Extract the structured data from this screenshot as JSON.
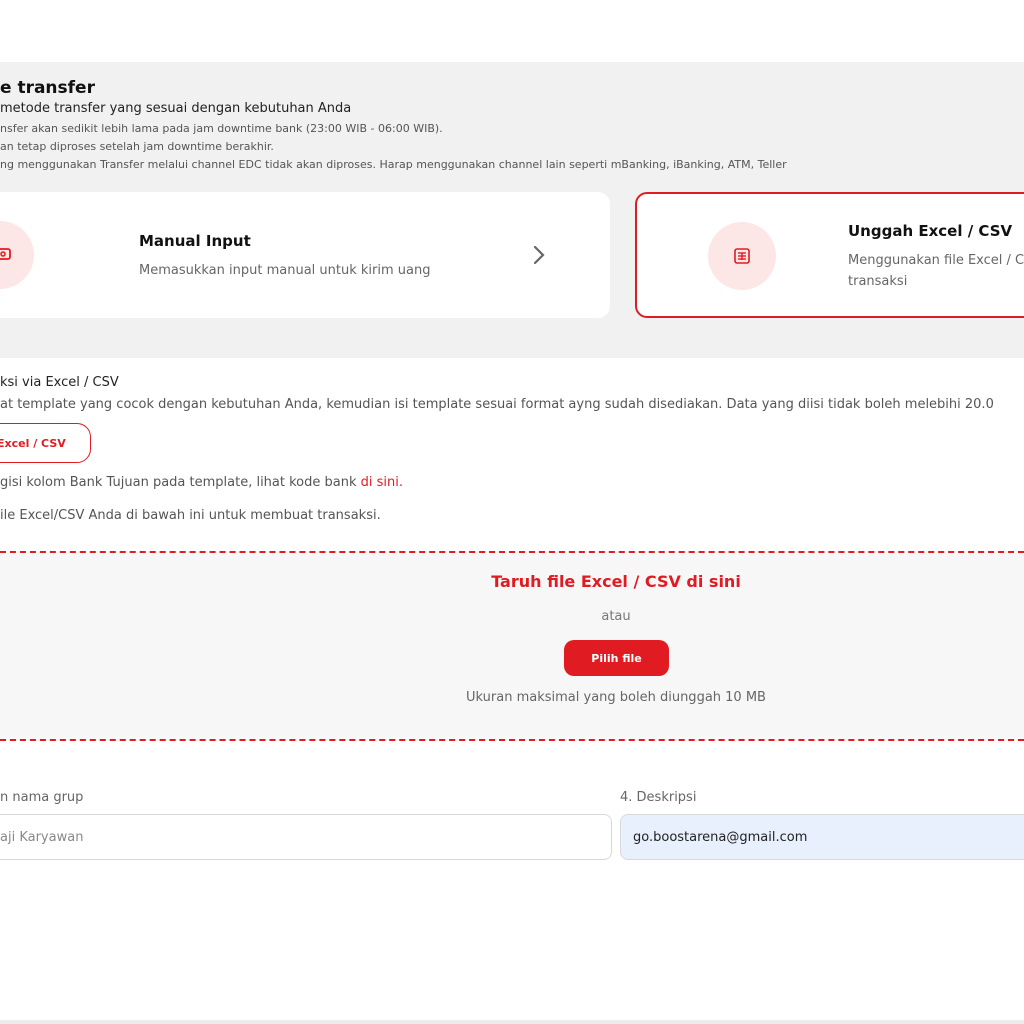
{
  "method": {
    "title": "e transfer",
    "subtitle": "metode transfer yang sesuai dengan kebutuhan Anda",
    "notes": [
      "nsfer akan sedikit lebih lama pada jam downtime bank (23:00 WIB - 06:00 WIB).",
      "an tetap diproses setelah jam downtime berakhir.",
      "ng menggunakan Transfer melalui channel EDC tidak akan diproses. Harap menggunakan channel lain seperti mBanking, iBanking, ATM, Teller"
    ],
    "cards": {
      "manual": {
        "title": "Manual Input",
        "desc": "Memasukkan input manual untuk kirim uang"
      },
      "upload": {
        "title": "Unggah Excel / CSV",
        "desc_line1": "Menggunakan file Excel / C",
        "desc_line2": "transaksi"
      }
    }
  },
  "upload": {
    "title": "ksi via Excel / CSV",
    "desc": "at template yang cocok dengan kebutuhan Anda, kemudian isi template sesuai format ayng sudah disediakan. Data yang diisi tidak boleh melebihi 20.0",
    "template_button": "Excel / CSV",
    "bank_code_text": "gisi kolom Bank Tujuan pada template, lihat kode bank",
    "bank_code_link": "di sini.",
    "instruction": "ile Excel/CSV Anda di bawah ini untuk membuat transaksi.",
    "dropzone": {
      "title": "Taruh file Excel / CSV di sini",
      "or": "atau",
      "button": "Pilih file",
      "max_size": "Ukuran maksimal yang boleh diunggah 10 MB"
    }
  },
  "form": {
    "group_label": "n nama grup",
    "group_value": "aji Karyawan",
    "desc_label": "4. Deskripsi",
    "desc_value": "go.boostarena@gmail.com"
  },
  "colors": {
    "accent": "#e11b22",
    "panel": "#f1f1f1",
    "icon_bg": "#fde6e6",
    "input_filled": "#e9f0fd"
  },
  "icons": {
    "manual": "hand-cash-icon",
    "upload": "spreadsheet-icon",
    "chevron": "chevron-right-icon"
  }
}
